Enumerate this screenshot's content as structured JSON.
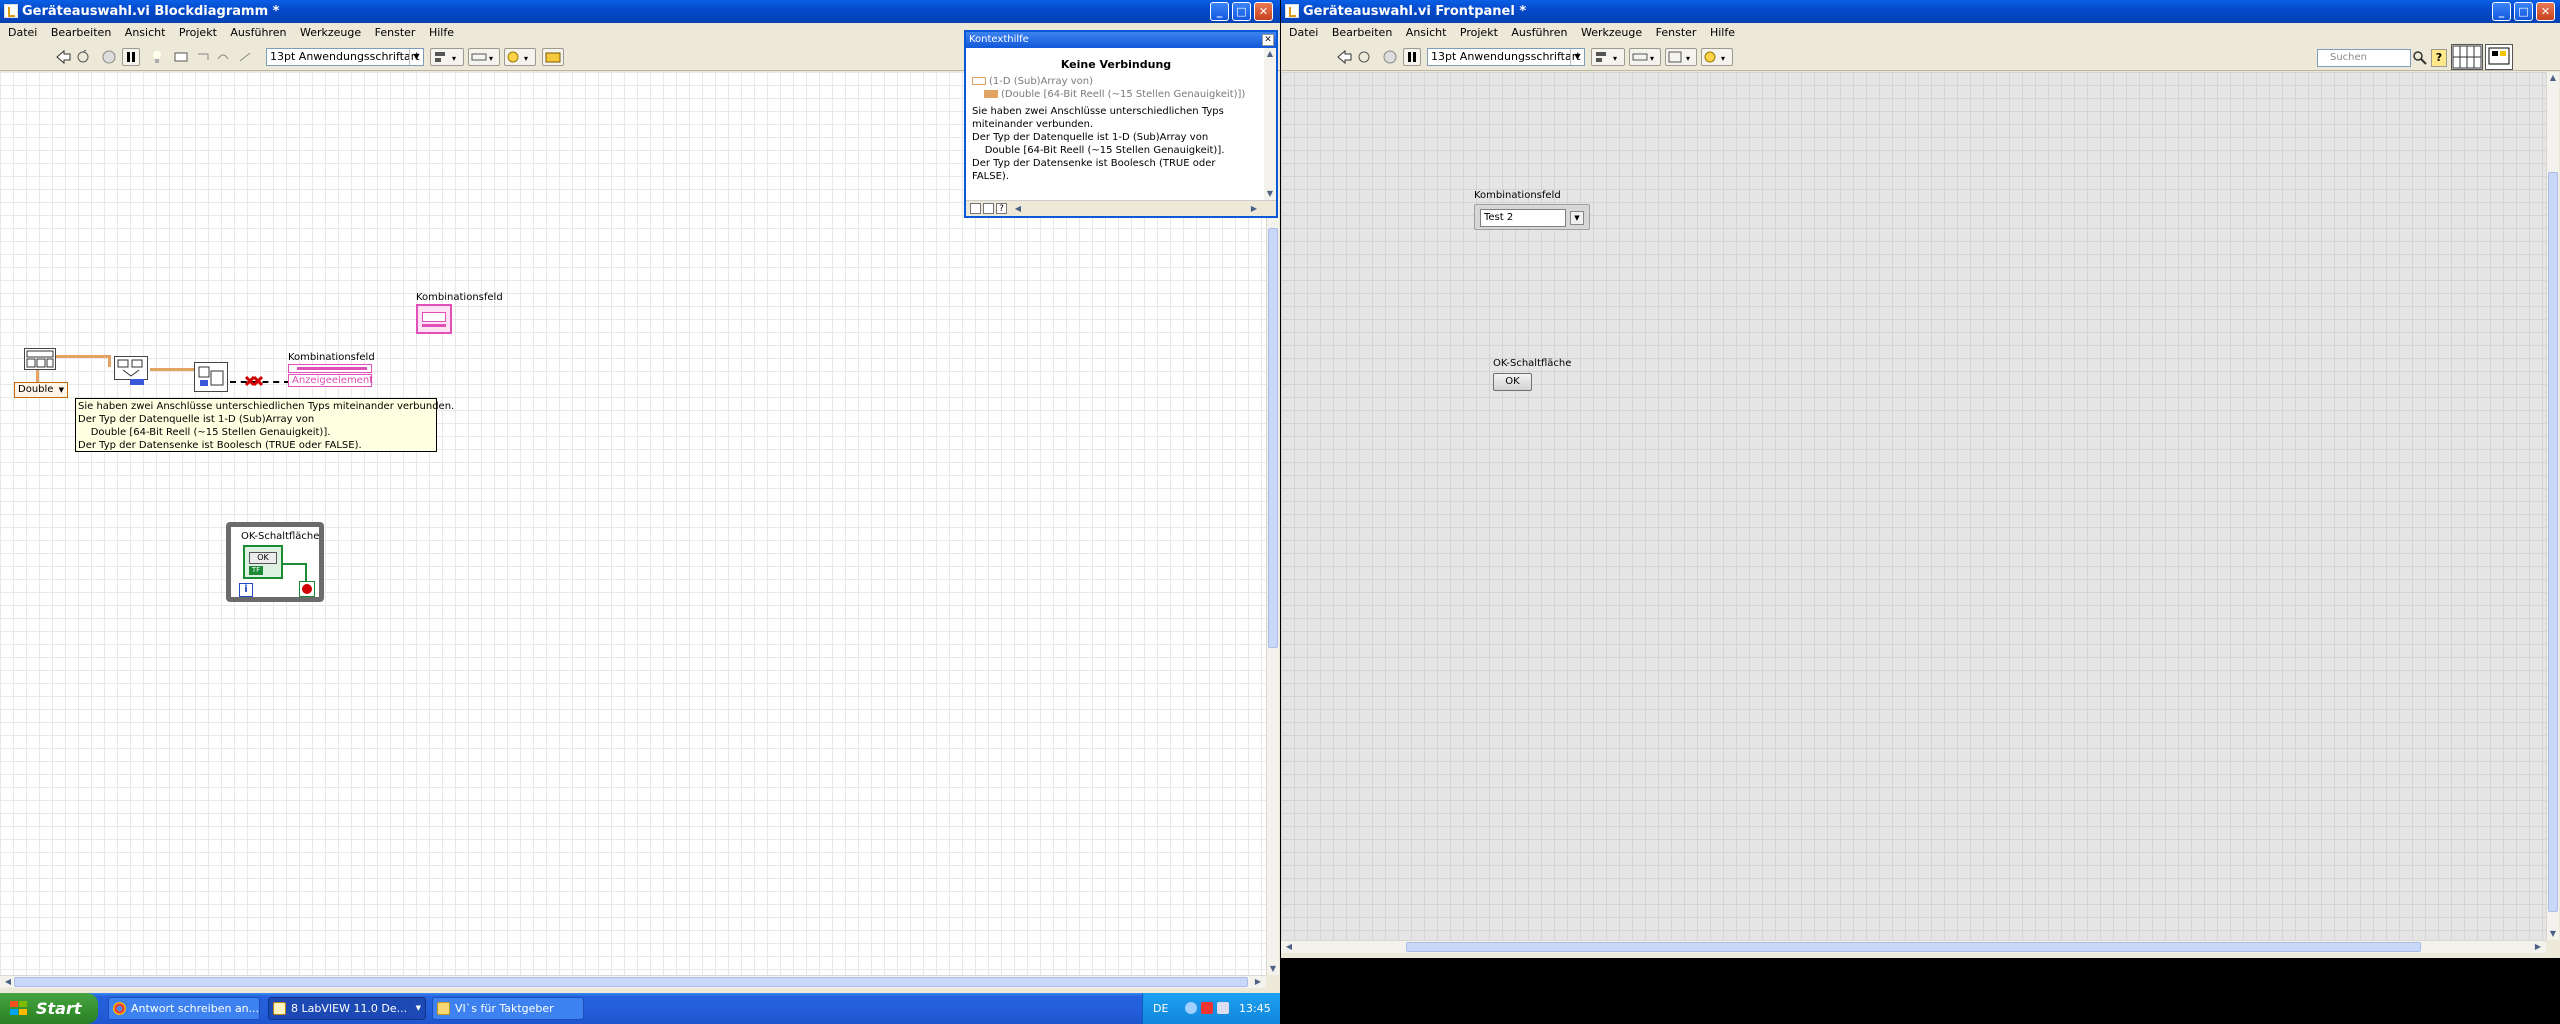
{
  "block_diagram_window": {
    "title": "Geräteauswahl.vi Blockdiagramm *",
    "menu": [
      "Datei",
      "Bearbeiten",
      "Ansicht",
      "Projekt",
      "Ausführen",
      "Werkzeuge",
      "Fenster",
      "Hilfe"
    ],
    "font_select": "13pt Anwendungsschriftart",
    "controls": {
      "minimize": "_",
      "maximize": "□",
      "close": "✕"
    },
    "diagram": {
      "numeric_type": "Double",
      "terminal_label_1": "Kombinationsfeld",
      "terminal_label_2": "Kombinationsfeld",
      "indicator_text": "Anzeigeelement",
      "loop_label": "OK-Schaltfläche",
      "loop_button_text": "OK",
      "loop_tf_text": "TF",
      "loop_index": "i",
      "tooltip": "Sie haben zwei Anschlüsse unterschiedlichen Typs miteinander verbunden.\nDer Typ der Datenquelle ist 1-D (Sub)Array von\n    Double [64-Bit Reell (~15 Stellen Genauigkeit)].\nDer Typ der Datensenke ist Boolesch (TRUE oder FALSE)."
    }
  },
  "context_help": {
    "title": "Kontexthilfe",
    "close": "✕",
    "heading": "Keine Verbindung",
    "type_line_1": "(1-D (Sub)Array von)",
    "type_line_2": "(Double [64-Bit Reell (~15 Stellen Genauigkeit)])",
    "text": "Sie haben zwei Anschlüsse unterschiedlichen Typs\nmiteinander verbunden.\nDer Typ der Datenquelle ist 1-D (Sub)Array von\n    Double [64-Bit Reell (~15 Stellen Genauigkeit)].\nDer Typ der Datensenke ist Boolesch (TRUE oder\nFALSE).",
    "help_button": "?"
  },
  "front_panel_window": {
    "title": "Geräteauswahl.vi Frontpanel *",
    "menu": [
      "Datei",
      "Bearbeiten",
      "Ansicht",
      "Projekt",
      "Ausführen",
      "Werkzeuge",
      "Fenster",
      "Hilfe"
    ],
    "font_select": "13pt Anwendungsschriftart",
    "search_placeholder": "Suchen",
    "help_button": "?",
    "controls": {
      "minimize": "_",
      "maximize": "□",
      "close": "✕"
    },
    "combo_label": "Kombinationsfeld",
    "combo_value": "Test 2",
    "ok_label": "OK-Schaltfläche",
    "ok_text": "OK"
  },
  "taskbar": {
    "start": "Start",
    "tasks": [
      {
        "label": "Antwort schreiben an...",
        "active": false
      },
      {
        "label": "8 LabVIEW 11.0 De...",
        "active": true
      },
      {
        "label": "VI`s für Taktgeber",
        "active": false
      }
    ],
    "language": "DE",
    "clock": "13:45"
  },
  "colors": {
    "titlebar": "#0548c8",
    "wire_double": "#e1a463",
    "wire_string": "#e14fb8",
    "tooltip_bg": "#ffffe1"
  }
}
